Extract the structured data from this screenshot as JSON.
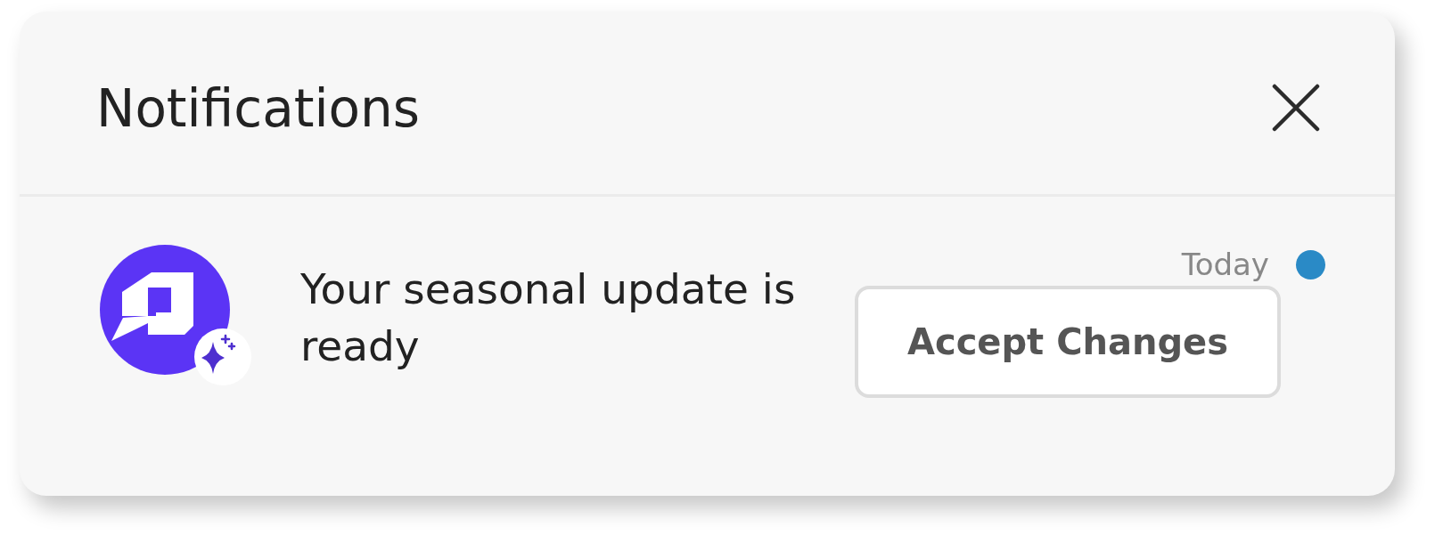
{
  "panel": {
    "title": "Notifications"
  },
  "notifications": [
    {
      "message": "Your seasonal update is ready",
      "time": "Today",
      "unread": true,
      "action": "Accept Changes"
    }
  ]
}
